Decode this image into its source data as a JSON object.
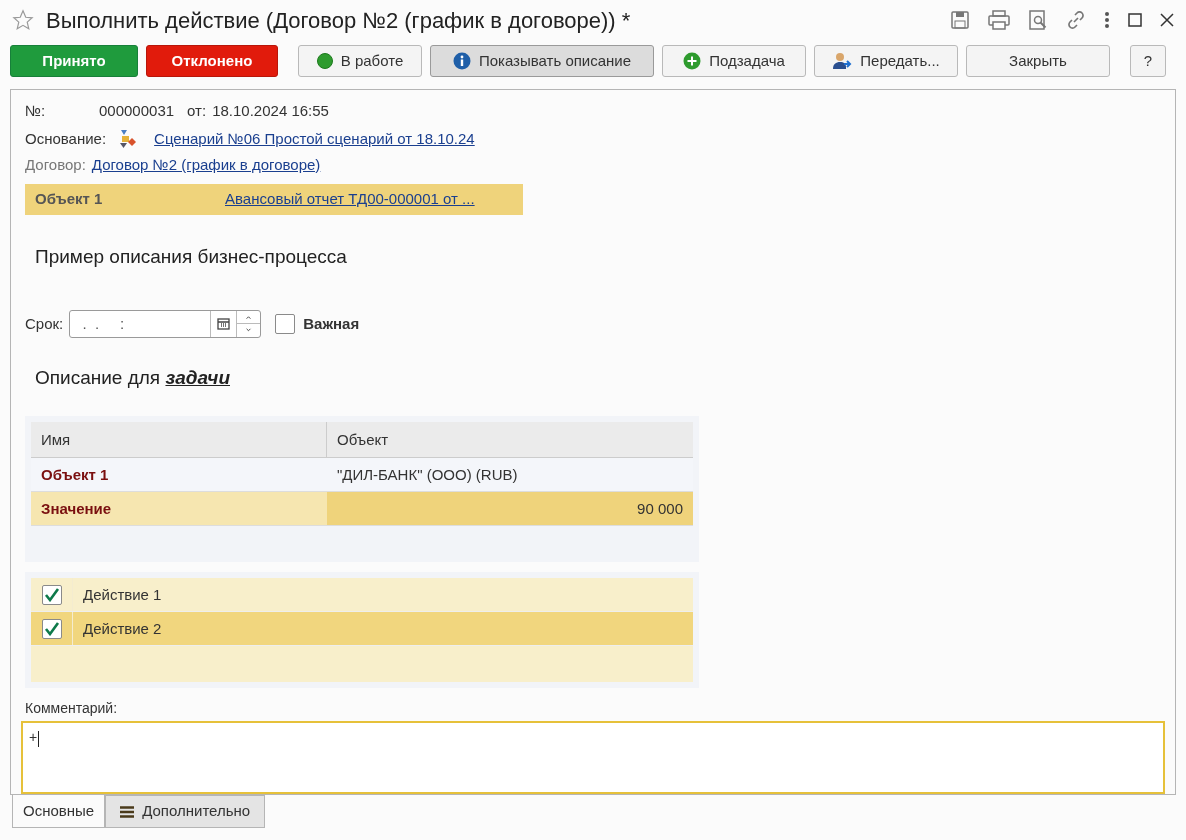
{
  "window": {
    "title": "Выполнить действие (Договор №2 (график в договоре)) *"
  },
  "toolbar": [
    {
      "label": "Принято",
      "kind": "accept"
    },
    {
      "label": "Отклонено",
      "kind": "reject"
    },
    {
      "label": "В работе",
      "kind": "status"
    },
    {
      "label": "Показывать описание",
      "kind": "info",
      "selected": true
    },
    {
      "label": "Подзадача",
      "kind": "add"
    },
    {
      "label": "Передать...",
      "kind": "person"
    },
    {
      "label": "Закрыть",
      "kind": "plain"
    },
    {
      "label": "?",
      "kind": "help"
    }
  ],
  "header": {
    "number_label": "№:",
    "number": "000000031",
    "date_label": "от:",
    "date": "18.10.2024 16:55",
    "basis_label": "Основание:",
    "basis": "Сценарий №06 Простой сценарий от 18.10.24",
    "contract_label": "Договор:",
    "contract": "Договор №2 (график в договоре)"
  },
  "object_row": {
    "label": "Объект 1",
    "value": "Авансовый отчет ТД00-000001 от ..."
  },
  "description_title": "Пример описания бизнес-процесса",
  "deadline": {
    "label": "Срок:",
    "value": " .  .     :  "
  },
  "important": {
    "label": "Важная",
    "checked": false
  },
  "task_title": "Описание для **задачи**",
  "table": {
    "columns": [
      "Имя",
      "Объект"
    ],
    "rows": [
      {
        "name": "Объект 1",
        "value": "\"ДИЛ-БАНК\" (ООО) (RUB)",
        "selected": false
      },
      {
        "name": "Значение",
        "value": "90 000",
        "selected": true
      }
    ]
  },
  "actions": [
    {
      "label": "Действие 1",
      "checked": true,
      "selected": false
    },
    {
      "label": "Действие 2",
      "checked": true,
      "selected": true
    }
  ],
  "comment": {
    "label": "Комментарий:",
    "value": "+"
  },
  "tabs": [
    {
      "label": "Основные",
      "selected": true
    },
    {
      "label": "Дополнительно",
      "selected": false
    }
  ]
}
